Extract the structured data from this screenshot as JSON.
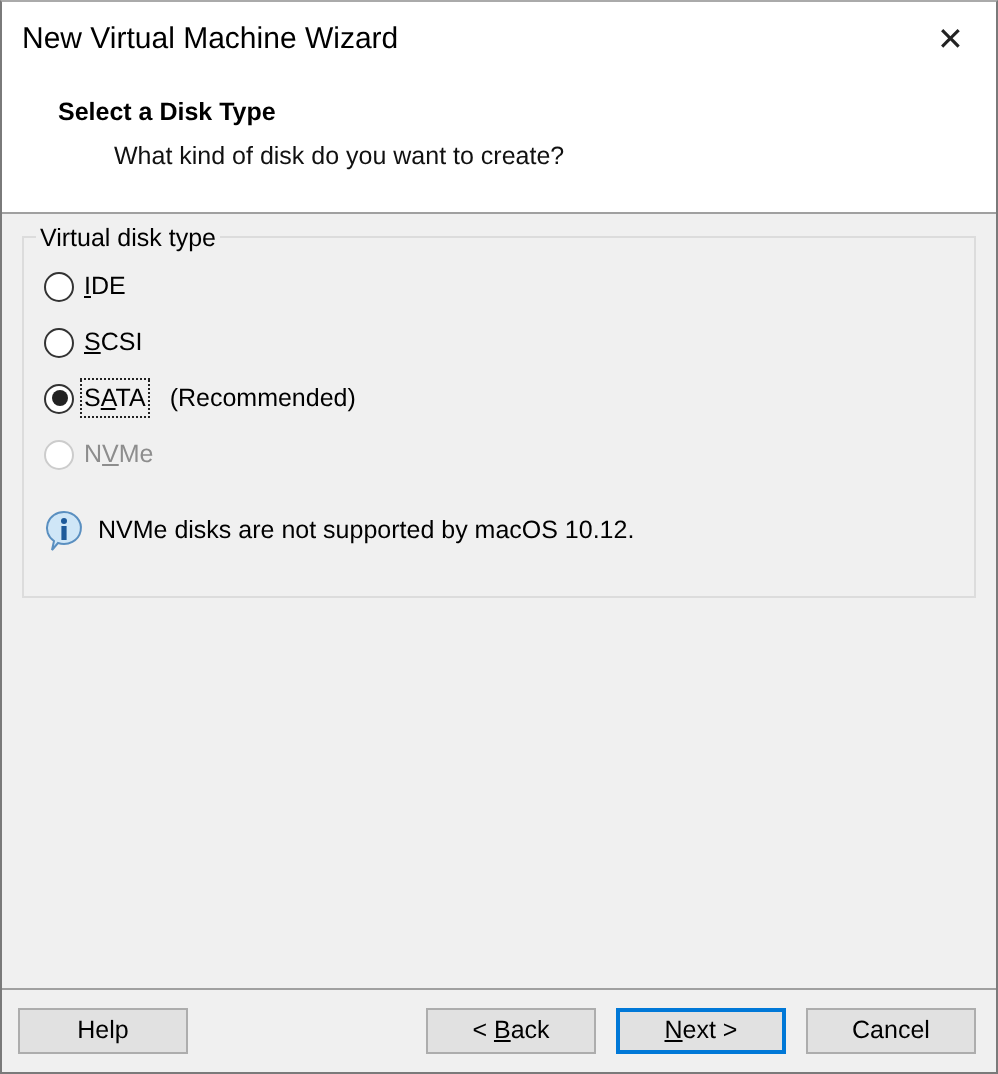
{
  "window": {
    "title": "New Virtual Machine Wizard",
    "close": "✕"
  },
  "header": {
    "title": "Select a Disk Type",
    "subtitle": "What kind of disk do you want to create?"
  },
  "group": {
    "legend": "Virtual disk type",
    "options": [
      {
        "key": "I",
        "post": "DE",
        "selected": false,
        "disabled": false,
        "focused": false
      },
      {
        "key": "S",
        "post": "CSI",
        "selected": false,
        "disabled": false,
        "focused": false
      },
      {
        "pre": "S",
        "key": "A",
        "post": "TA",
        "extra": "(Recommended)",
        "selected": true,
        "disabled": false,
        "focused": true
      },
      {
        "pre": "N",
        "key": "V",
        "post": "Me",
        "selected": false,
        "disabled": true,
        "focused": false
      }
    ],
    "note": "NVMe disks are not supported by macOS 10.12."
  },
  "buttons": [
    {
      "post": "Help",
      "default": false
    },
    {
      "pre": "< ",
      "key": "B",
      "post": "ack",
      "default": false
    },
    {
      "key": "N",
      "post": "ext >",
      "default": true
    },
    {
      "post": "Cancel",
      "default": false
    }
  ]
}
